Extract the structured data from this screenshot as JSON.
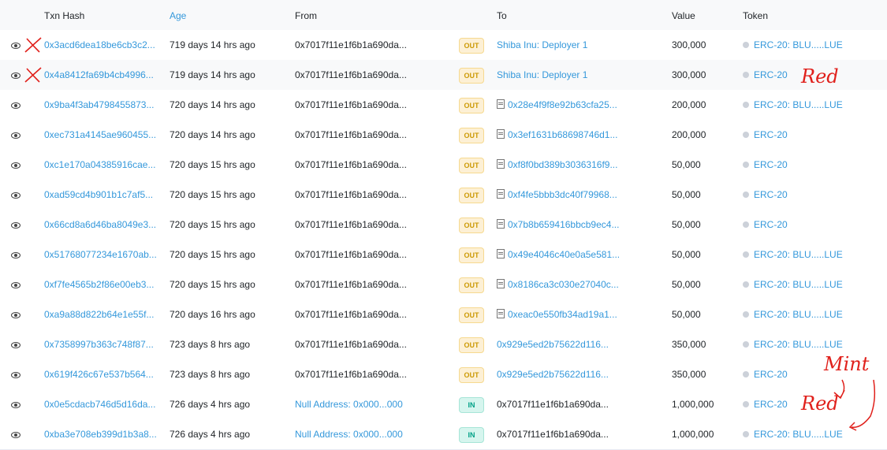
{
  "columns": {
    "txn_hash": "Txn Hash",
    "age": "Age",
    "from": "From",
    "to": "To",
    "value": "Value",
    "token": "Token"
  },
  "rows": [
    {
      "hash": "0x3acd6dea18be6cb3c2...",
      "age": "719 days 14 hrs ago",
      "from": "0x7017f11e1f6b1a690da...",
      "dir": "OUT",
      "to": "Shiba Inu: Deployer 1",
      "to_contract": false,
      "to_link": true,
      "value": "300,000",
      "token": "ERC-20: BLU.....LUE"
    },
    {
      "hash": "0x4a8412fa69b4cb4996...",
      "age": "719 days 14 hrs ago",
      "from": "0x7017f11e1f6b1a690da...",
      "dir": "OUT",
      "to": "Shiba Inu: Deployer 1",
      "to_contract": false,
      "to_link": true,
      "value": "300,000",
      "token": "ERC-20"
    },
    {
      "hash": "0x9ba4f3ab4798455873...",
      "age": "720 days 14 hrs ago",
      "from": "0x7017f11e1f6b1a690da...",
      "dir": "OUT",
      "to": "0x28e4f9f8e92b63cfa25...",
      "to_contract": true,
      "to_link": true,
      "value": "200,000",
      "token": "ERC-20: BLU.....LUE"
    },
    {
      "hash": "0xec731a4145ae960455...",
      "age": "720 days 14 hrs ago",
      "from": "0x7017f11e1f6b1a690da...",
      "dir": "OUT",
      "to": "0x3ef1631b68698746d1...",
      "to_contract": true,
      "to_link": true,
      "value": "200,000",
      "token": "ERC-20"
    },
    {
      "hash": "0xc1e170a04385916cae...",
      "age": "720 days 15 hrs ago",
      "from": "0x7017f11e1f6b1a690da...",
      "dir": "OUT",
      "to": "0xf8f0bd389b3036316f9...",
      "to_contract": true,
      "to_link": true,
      "value": "50,000",
      "token": "ERC-20"
    },
    {
      "hash": "0xad59cd4b901b1c7af5...",
      "age": "720 days 15 hrs ago",
      "from": "0x7017f11e1f6b1a690da...",
      "dir": "OUT",
      "to": "0xf4fe5bbb3dc40f79968...",
      "to_contract": true,
      "to_link": true,
      "value": "50,000",
      "token": "ERC-20"
    },
    {
      "hash": "0x66cd8a6d46ba8049e3...",
      "age": "720 days 15 hrs ago",
      "from": "0x7017f11e1f6b1a690da...",
      "dir": "OUT",
      "to": "0x7b8b659416bbcb9ec4...",
      "to_contract": true,
      "to_link": true,
      "value": "50,000",
      "token": "ERC-20"
    },
    {
      "hash": "0x51768077234e1670ab...",
      "age": "720 days 15 hrs ago",
      "from": "0x7017f11e1f6b1a690da...",
      "dir": "OUT",
      "to": "0x49e4046c40e0a5e581...",
      "to_contract": true,
      "to_link": true,
      "value": "50,000",
      "token": "ERC-20: BLU.....LUE"
    },
    {
      "hash": "0xf7fe4565b2f86e00eb3...",
      "age": "720 days 15 hrs ago",
      "from": "0x7017f11e1f6b1a690da...",
      "dir": "OUT",
      "to": "0x8186ca3c030e27040c...",
      "to_contract": true,
      "to_link": true,
      "value": "50,000",
      "token": "ERC-20: BLU.....LUE"
    },
    {
      "hash": "0xa9a88d822b64e1e55f...",
      "age": "720 days 16 hrs ago",
      "from": "0x7017f11e1f6b1a690da...",
      "dir": "OUT",
      "to": "0xeac0e550fb34ad19a1...",
      "to_contract": true,
      "to_link": true,
      "value": "50,000",
      "token": "ERC-20: BLU.....LUE"
    },
    {
      "hash": "0x7358997b363c748f87...",
      "age": "723 days 8 hrs ago",
      "from": "0x7017f11e1f6b1a690da...",
      "dir": "OUT",
      "to": "0x929e5ed2b75622d116...",
      "to_contract": false,
      "to_link": true,
      "value": "350,000",
      "token": "ERC-20: BLU.....LUE"
    },
    {
      "hash": "0x619f426c67e537b564...",
      "age": "723 days 8 hrs ago",
      "from": "0x7017f11e1f6b1a690da...",
      "dir": "OUT",
      "to": "0x929e5ed2b75622d116...",
      "to_contract": false,
      "to_link": true,
      "value": "350,000",
      "token": "ERC-20"
    },
    {
      "hash": "0x0e5cdacb746d5d16da...",
      "age": "726 days 4 hrs ago",
      "from": "Null Address: 0x000...000",
      "from_link": true,
      "dir": "IN",
      "to": "0x7017f11e1f6b1a690da...",
      "to_contract": false,
      "to_link": false,
      "value": "1,000,000",
      "token": "ERC-20"
    },
    {
      "hash": "0xba3e708eb399d1b3a8...",
      "age": "726 days 4 hrs ago",
      "from": "Null Address: 0x000...000",
      "from_link": true,
      "dir": "IN",
      "to": "0x7017f11e1f6b1a690da...",
      "to_contract": false,
      "to_link": false,
      "value": "1,000,000",
      "token": "ERC-20: BLU.....LUE"
    }
  ],
  "annotations": {
    "red_1": "Red",
    "red_2": "Red",
    "mint": "Mint"
  },
  "colors": {
    "link": "#3498db",
    "annotation": "#e0201b",
    "out_badge": "#cc9a06",
    "in_badge": "#00a186"
  }
}
